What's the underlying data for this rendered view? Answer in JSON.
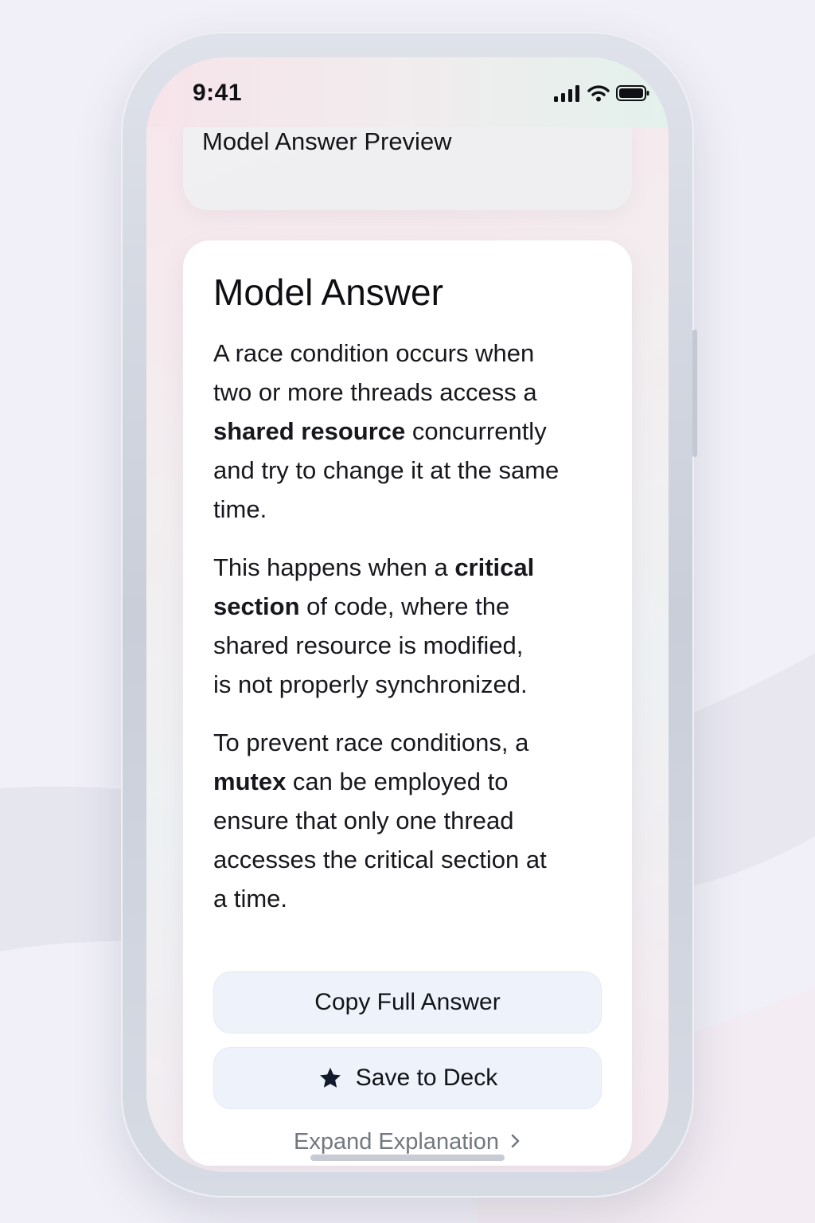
{
  "status_bar": {
    "time": "9:41",
    "icons": [
      "signal-icon",
      "wifi-icon",
      "battery-icon"
    ]
  },
  "preview_card": {
    "title": "Model Answer Preview"
  },
  "answer_card": {
    "title": "Model Answer",
    "paragraph1": {
      "line1": "A race condition occurs when",
      "line2": "two or more threads access a",
      "line3_bold": "shared resource",
      "line3_rest": " concurrently",
      "line4": "and try to change it at the same",
      "line5": "time."
    },
    "paragraph2": {
      "line1_pre": "This happens when a ",
      "line1_bold": "critical",
      "line2_bold": "section",
      "line2_rest": " of code, where the",
      "line3": "shared resource is modified,",
      "line4": "is not properly synchronized."
    },
    "paragraph3": {
      "line1": "To prevent race conditions, a",
      "line2_bold": "mutex",
      "line2_rest": " can be employed to",
      "line3": "ensure that only one thread",
      "line4": "accesses the critical section at",
      "line5": "a time."
    },
    "copy_button": "Copy Full Answer",
    "save_button": "Save to Deck",
    "save_icon": "star-icon",
    "expand_link": "Expand Explanation",
    "expand_icon": "chevron-right-icon"
  },
  "colors": {
    "button_bg": "#edf2fb",
    "link_text": "#737780",
    "card_bg": "#ffffff"
  }
}
